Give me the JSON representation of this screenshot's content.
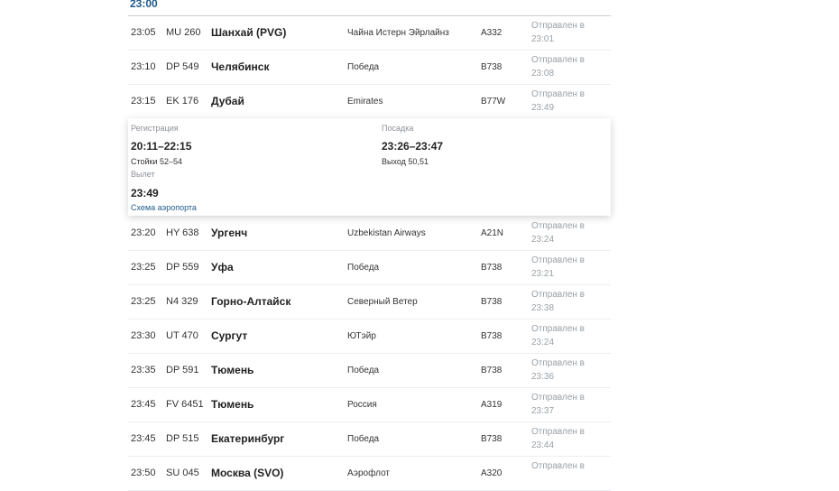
{
  "hour_label": "23:00",
  "flights_top": [
    {
      "time": "23:05",
      "flight": "MU 260",
      "destination": "Шанхай (PVG)",
      "airline": "Чайна Истерн Эйрлайнз",
      "aircraft": "A332",
      "status_line1": "Отправлен в",
      "status_line2": "23:01"
    },
    {
      "time": "23:10",
      "flight": "DP 549",
      "destination": "Челябинск",
      "airline": "Победа",
      "aircraft": "B738",
      "status_line1": "Отправлен в",
      "status_line2": "23:08"
    },
    {
      "time": "23:15",
      "flight": "EK 176",
      "destination": "Дубай",
      "airline": "Emirates",
      "aircraft": "B77W",
      "status_line1": "Отправлен в",
      "status_line2": "23:49"
    }
  ],
  "details": {
    "registration_label": "Регистрация",
    "registration_time": "20:11–22:15",
    "counters": "Стойки 52–54",
    "boarding_label": "Посадка",
    "boarding_time": "23:26–23:47",
    "gate": "Выход 50,51",
    "departure_label": "Вылет",
    "departure_time": "23:49",
    "map_link": "Схема аэропорта"
  },
  "flights_bottom": [
    {
      "time": "23:20",
      "flight": "HY 638",
      "destination": "Ургенч",
      "airline": "Uzbekistan Airways",
      "aircraft": "A21N",
      "status_line1": "Отправлен в",
      "status_line2": "23:24"
    },
    {
      "time": "23:25",
      "flight": "DP 559",
      "destination": "Уфа",
      "airline": "Победа",
      "aircraft": "B738",
      "status_line1": "Отправлен в",
      "status_line2": "23:21"
    },
    {
      "time": "23:25",
      "flight": "N4 329",
      "destination": "Горно-Алтайск",
      "airline": "Северный Ветер",
      "aircraft": "B738",
      "status_line1": "Отправлен в",
      "status_line2": "23:38"
    },
    {
      "time": "23:30",
      "flight": "UT 470",
      "destination": "Сургут",
      "airline": "ЮТэйр",
      "aircraft": "B738",
      "status_line1": "Отправлен в",
      "status_line2": "23:24"
    },
    {
      "time": "23:35",
      "flight": "DP 591",
      "destination": "Тюмень",
      "airline": "Победа",
      "aircraft": "B738",
      "status_line1": "Отправлен в",
      "status_line2": "23:36"
    },
    {
      "time": "23:45",
      "flight": "FV 6451",
      "destination": "Тюмень",
      "airline": "Россия",
      "aircraft": "A319",
      "status_line1": "Отправлен в",
      "status_line2": "23:37"
    },
    {
      "time": "23:45",
      "flight": "DP 515",
      "destination": "Екатеринбург",
      "airline": "Победа",
      "aircraft": "B738",
      "status_line1": "Отправлен в",
      "status_line2": "23:44"
    },
    {
      "time": "23:50",
      "flight": "SU 045",
      "destination": "Москва (SVO)",
      "airline": "Аэрофлот",
      "aircraft": "A320",
      "status_line1": "Отправлен в",
      "status_line2": ""
    }
  ]
}
